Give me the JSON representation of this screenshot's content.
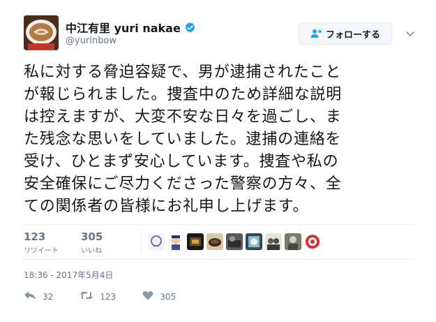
{
  "user": {
    "display_name": "中江有里 yuri nakae",
    "handle": "@yurinbow",
    "verified": true
  },
  "follow_button_label": "フォローする",
  "tweet_lines": [
    "私に対する脅迫容疑で、男が逮捕されたこと",
    "が報じられました。捜査中のため詳細な説明",
    "は控えますが、大変不安な日々を過ごし、ま",
    "た残念な思いをしていました。逮捕の連絡を",
    "受け、ひとまず安心しています。捜査や私の",
    "安全確保にご尽力くださった警察の方々、全",
    "ての関係者の皆様にお礼申し上げます。"
  ],
  "stats": {
    "retweets": {
      "count": "123",
      "label": "リツイート"
    },
    "likes": {
      "count": "305",
      "label": "いいね"
    }
  },
  "timestamp": "18:36 - 2017年5月4日",
  "actions": {
    "reply_count": "32",
    "retweet_count": "123",
    "like_count": "305"
  },
  "colors": {
    "text": "#14171a",
    "muted": "#657786",
    "verified": "#1da1f2",
    "divider": "#e6ecf0"
  }
}
